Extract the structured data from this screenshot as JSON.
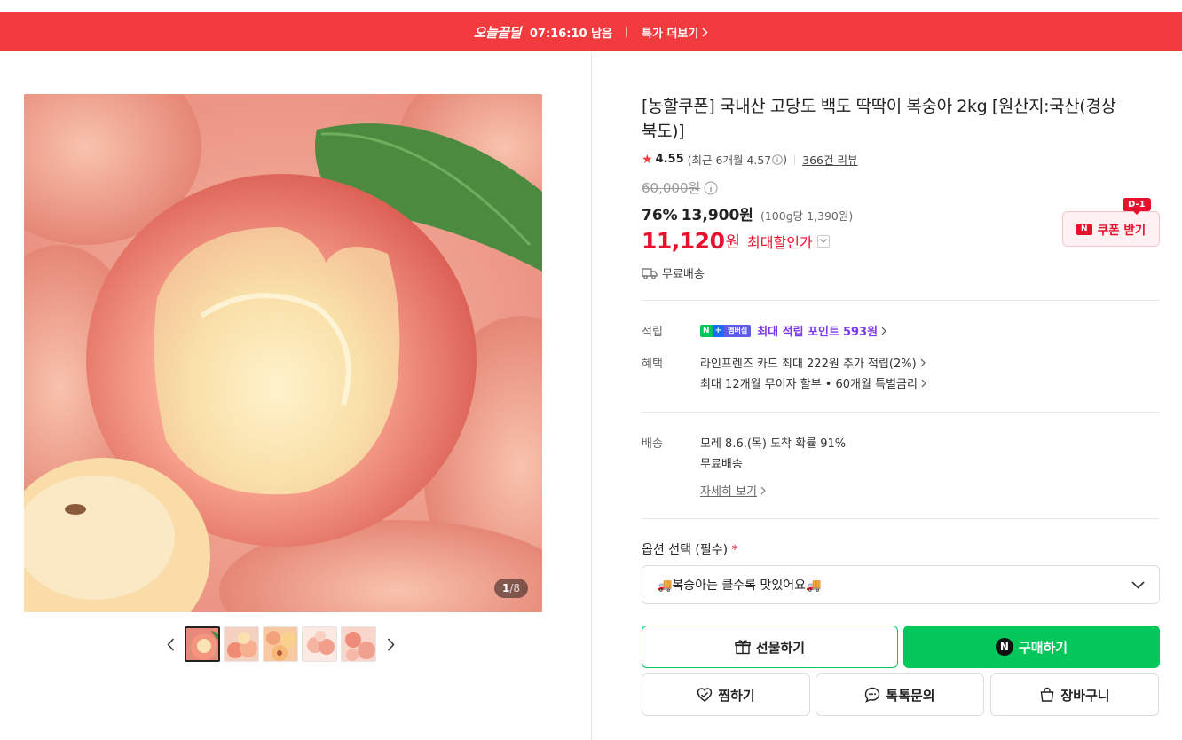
{
  "topbar": {
    "brand": "오늘끝딜",
    "timer": "07:16:10 남음",
    "more": "특가 더보기"
  },
  "gallery": {
    "counter_current": "1",
    "counter_total": "/8",
    "thumbnails": 5
  },
  "product": {
    "title": "[농할쿠폰] 국내산 고당도 백도 딱딱이 복숭아 2kg [원산지:국산(경상북도)]",
    "rating": "4.55",
    "recent_rating": "(최근 6개월 4.57",
    "recent_rating_close": ")",
    "reviews": "366건 리뷰",
    "original_price": "60,000원",
    "discount_rate": "76%",
    "discount_price": "13,900원",
    "unit_price": "(100g당 1,390원)",
    "max_price": "11,120",
    "max_won": "원",
    "max_label": "최대할인가",
    "free_shipping": "무료배송"
  },
  "coupon": {
    "label": "쿠폰 받기",
    "dday": "D-1",
    "logo": "N"
  },
  "benefits": {
    "points_label": "적립",
    "points_text": "최대 적립 포인트",
    "points_value": "593원",
    "badge_n": "N",
    "badge_plus": "+",
    "badge_member": "멤버십",
    "benefit_label": "혜택",
    "benefit_1": "라인프렌즈 카드 최대 222원 추가 적립(2%)",
    "benefit_2": "최대 12개월 무이자 할부 • 60개월 특별금리"
  },
  "delivery": {
    "label": "배송",
    "arrival": "모레 8.6.(목) 도착 확률 91%",
    "fee": "무료배송",
    "detail": "자세히 보기"
  },
  "options": {
    "label": "옵션 선택 (필수)",
    "required_mark": "*",
    "selected": "🚚복숭아는 클수록 맛있어요🚚"
  },
  "buttons": {
    "gift": "선물하기",
    "buy": "구매하기",
    "wish": "찜하기",
    "talk": "톡톡문의",
    "cart": "장바구니"
  },
  "colors": {
    "accent_red": "#f23b3f",
    "naver_green": "#03c75a",
    "price_red": "#e8112d"
  }
}
